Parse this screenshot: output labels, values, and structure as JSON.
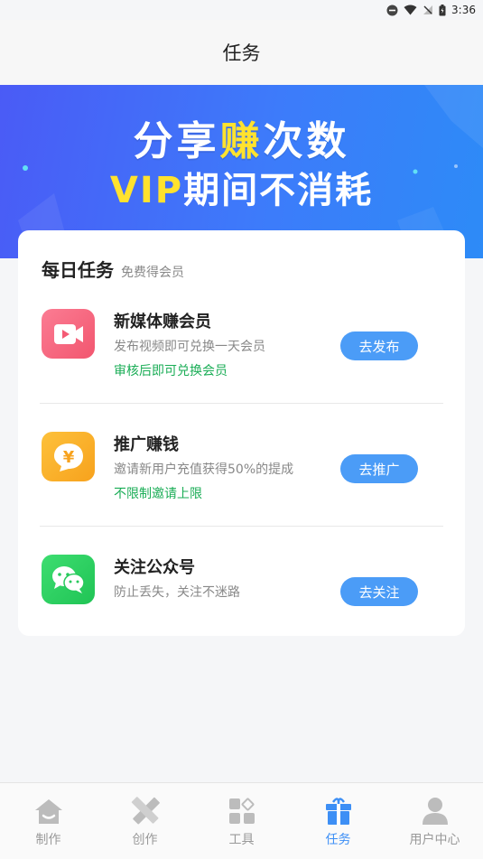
{
  "status_bar": {
    "time": "3:36"
  },
  "header": {
    "title": "任务"
  },
  "banner": {
    "line1_prefix": "分享",
    "line1_highlight": "赚",
    "line1_suffix": "次数",
    "line2_highlight": "VIP",
    "line2_suffix": "期间不消耗"
  },
  "daily": {
    "title": "每日任务",
    "subtitle": "免费得会员",
    "tasks": [
      {
        "icon": "video-icon",
        "name": "新媒体赚会员",
        "desc": "发布视频即可兑换一天会员",
        "note": "审核后即可兑换会员",
        "button": "去发布",
        "color": "#f7637e"
      },
      {
        "icon": "yen-chat-icon",
        "name": "推广赚钱",
        "desc": "邀请新用户充值获得50%的提成",
        "note": "不限制邀请上限",
        "button": "去推广",
        "color": "#fbb22a"
      },
      {
        "icon": "wechat-icon",
        "name": "关注公众号",
        "desc": "防止丢失，关注不迷路",
        "note": "",
        "button": "去关注",
        "color": "#2dd162"
      }
    ]
  },
  "tabbar": {
    "items": [
      {
        "label": "制作",
        "icon": "home-icon",
        "active": false
      },
      {
        "label": "创作",
        "icon": "pencil-ruler-icon",
        "active": false
      },
      {
        "label": "工具",
        "icon": "grid-icon",
        "active": false
      },
      {
        "label": "任务",
        "icon": "gift-icon",
        "active": true
      },
      {
        "label": "用户中心",
        "icon": "user-icon",
        "active": false
      }
    ]
  },
  "colors": {
    "accent": "#3d8ff5",
    "button": "#4b9cf7",
    "green": "#1aad56",
    "highlight": "#ffe22e"
  }
}
